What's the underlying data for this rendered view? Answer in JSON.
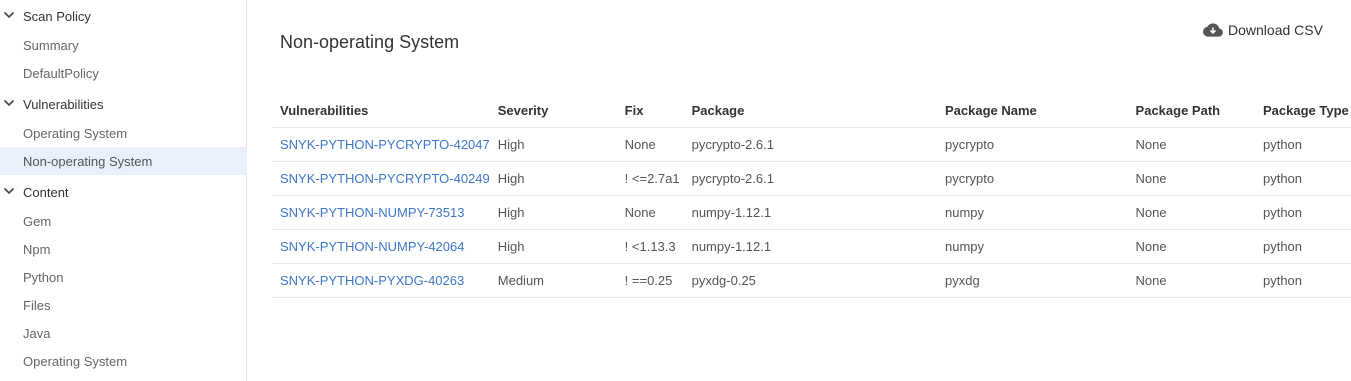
{
  "sidebar": {
    "groups": [
      {
        "label": "Scan Policy",
        "items": [
          "Summary",
          "DefaultPolicy"
        ]
      },
      {
        "label": "Vulnerabilities",
        "items": [
          "Operating System",
          "Non-operating System"
        ]
      },
      {
        "label": "Content",
        "items": [
          "Gem",
          "Npm",
          "Python",
          "Files",
          "Java",
          "Operating System"
        ]
      }
    ],
    "active_item": "Non-operating System"
  },
  "main": {
    "title": "Non-operating System",
    "download_label": "Download CSV",
    "table": {
      "headers": [
        "Vulnerabilities",
        "Severity",
        "Fix",
        "Package",
        "Package Name",
        "Package Path",
        "Package Type"
      ],
      "rows": [
        [
          "SNYK-PYTHON-PYCRYPTO-42047",
          "High",
          "None",
          "pycrypto-2.6.1",
          "pycrypto",
          "None",
          "python"
        ],
        [
          "SNYK-PYTHON-PYCRYPTO-40249",
          "High",
          "! <=2.7a1",
          "pycrypto-2.6.1",
          "pycrypto",
          "None",
          "python"
        ],
        [
          "SNYK-PYTHON-NUMPY-73513",
          "High",
          "None",
          "numpy-1.12.1",
          "numpy",
          "None",
          "python"
        ],
        [
          "SNYK-PYTHON-NUMPY-42064",
          "High",
          "! <1.13.3",
          "numpy-1.12.1",
          "numpy",
          "None",
          "python"
        ],
        [
          "SNYK-PYTHON-PYXDG-40263",
          "Medium",
          "! ==0.25",
          "pyxdg-0.25",
          "pyxdg",
          "None",
          "python"
        ]
      ]
    }
  },
  "colors": {
    "link": "#3d78c9",
    "active_bg": "#e8f1fb",
    "border": "#e6e6e6"
  },
  "icons": {
    "group_expander": "chevron-down-icon",
    "download": "cloud-download-icon"
  }
}
